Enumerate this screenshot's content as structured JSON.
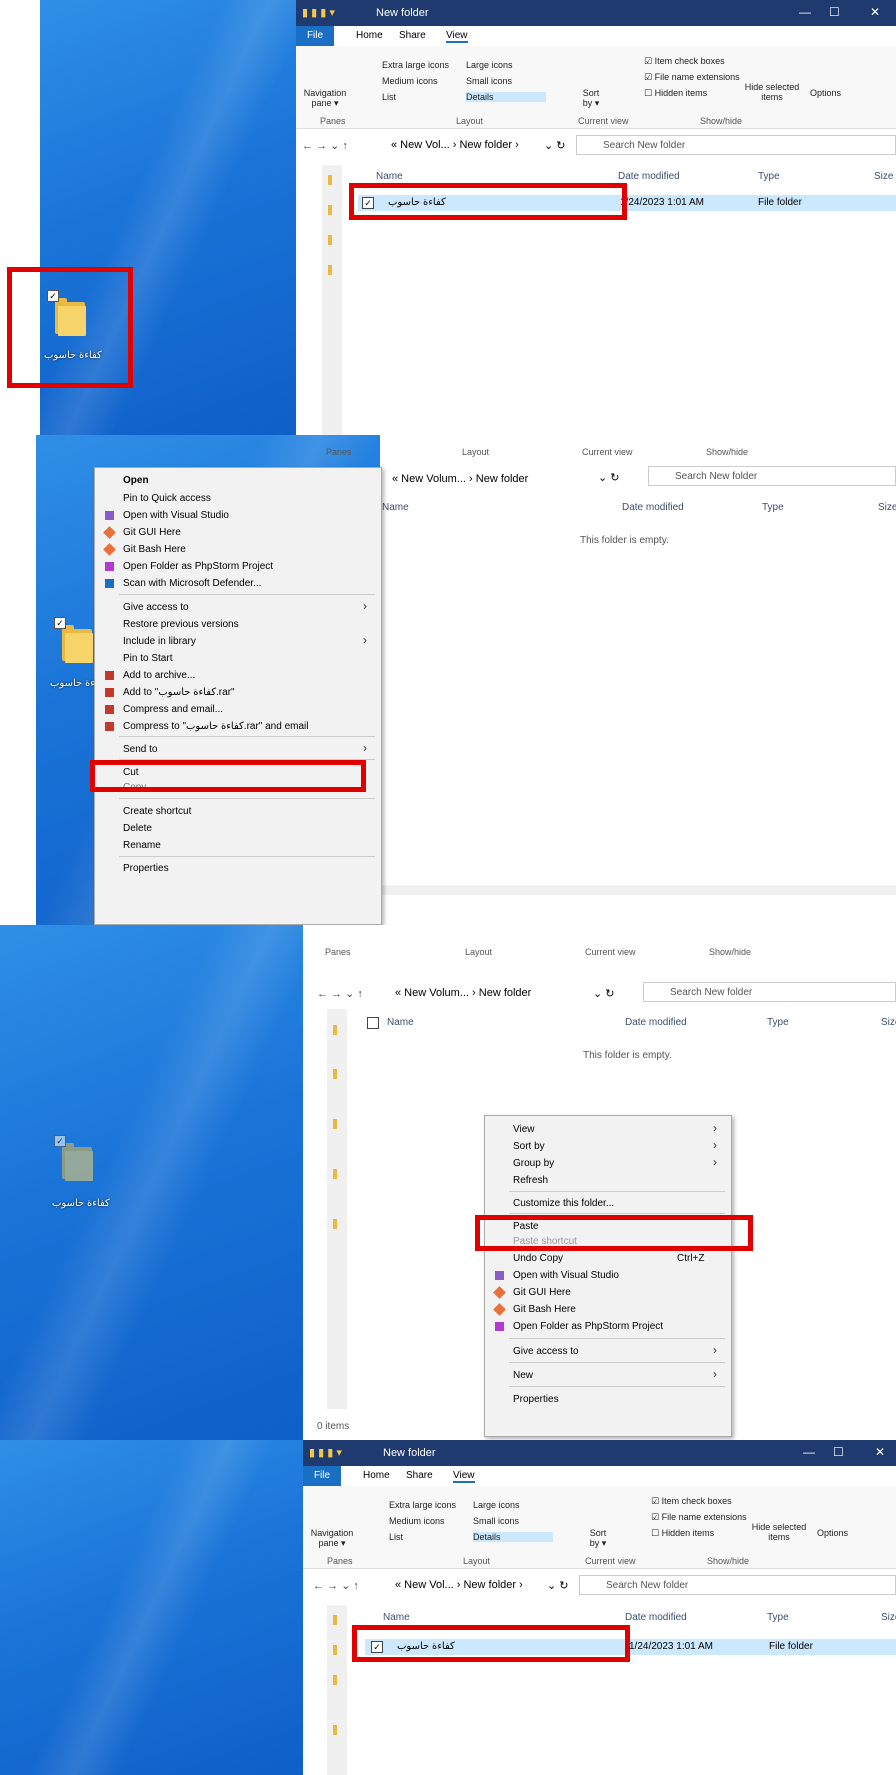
{
  "folder_name": "كفاءة حاسوب",
  "window": {
    "title": "New folder",
    "minimize": "—",
    "maximize": "☐",
    "close": "✕"
  },
  "ribbon": {
    "tabs": [
      "File",
      "Home",
      "Share",
      "View"
    ],
    "nav_pane": "Navigation pane ▾",
    "layout_items": [
      "Extra large icons",
      "Large icons",
      "Medium icons",
      "Small icons",
      "List",
      "Details"
    ],
    "sort_by": "Sort by ▾",
    "checks": [
      "Item check boxes",
      "File name extensions",
      "Hidden items"
    ],
    "hide_selected": "Hide selected items",
    "options": "Options",
    "groups": [
      "Panes",
      "Layout",
      "Current view",
      "Show/hide"
    ]
  },
  "address": {
    "path_short": "« New Vol... › New folder ›",
    "path_long": "« New Volum... › New folder",
    "search_placeholder": "Search New folder"
  },
  "columns": [
    "Name",
    "Date modified",
    "Type",
    "Size"
  ],
  "file_row": {
    "date": "1/24/2023 1:01 AM",
    "type": "File folder"
  },
  "empty_text": "This folder is empty.",
  "status_items": "0 items",
  "context_menu_file": {
    "items": [
      "Open",
      "Pin to Quick access",
      "Open with Visual Studio",
      "Git GUI Here",
      "Git Bash Here",
      "Open Folder as PhpStorm Project",
      "Scan with Microsoft Defender...",
      "Give access to",
      "Restore previous versions",
      "Include in library",
      "Pin to Start",
      "Add to archive...",
      "Add to \"كفاءة حاسوب.rar\"",
      "Compress and email...",
      "Compress to \"كفاءة حاسوب.rar\" and email",
      "Send to",
      "Cut",
      "Copy",
      "Create shortcut",
      "Delete",
      "Rename",
      "Properties"
    ]
  },
  "context_menu_background": {
    "items": [
      "View",
      "Sort by",
      "Group by",
      "Refresh",
      "Customize this folder...",
      "Paste",
      "Paste shortcut",
      "Undo Copy",
      "Open with Visual Studio",
      "Git GUI Here",
      "Git Bash Here",
      "Open Folder as PhpStorm Project",
      "Give access to",
      "New",
      "Properties"
    ],
    "undo_shortcut": "Ctrl+Z"
  },
  "colors": {
    "highlight": "#e00000",
    "selection": "#cce8ff",
    "titlebar": "#1f3a6e",
    "desktop": "#1a74d8"
  }
}
